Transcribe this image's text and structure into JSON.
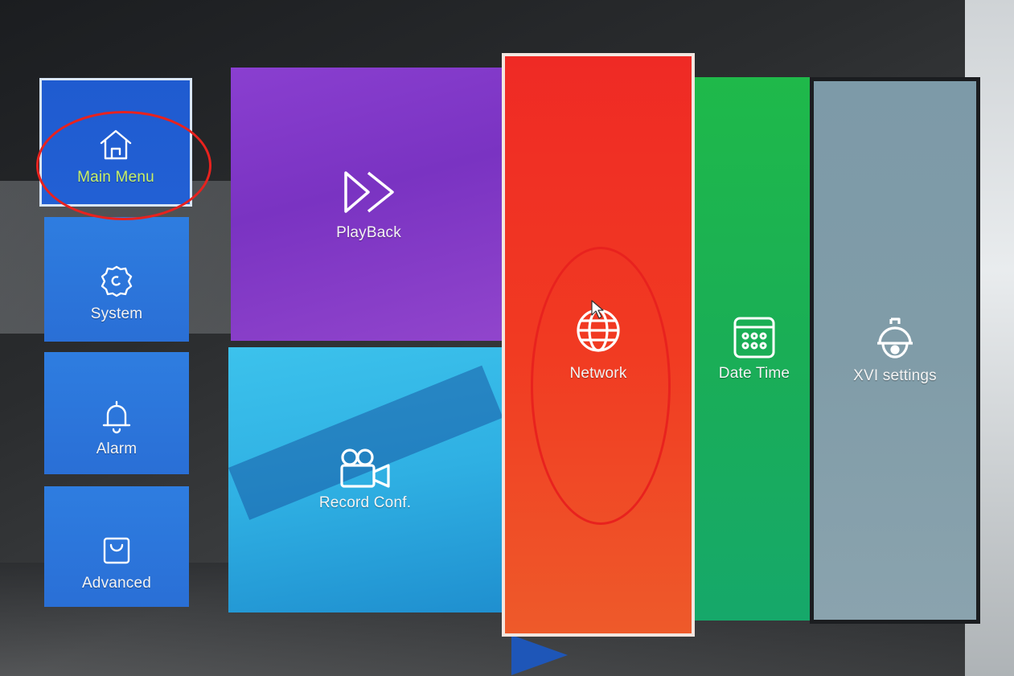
{
  "main_menu": {
    "sidebar": [
      {
        "id": "main-menu",
        "label": "Main Menu",
        "icon": "home-icon",
        "active": true
      },
      {
        "id": "system",
        "label": "System",
        "icon": "gear-icon"
      },
      {
        "id": "alarm",
        "label": "Alarm",
        "icon": "bell-icon"
      },
      {
        "id": "advanced",
        "label": "Advanced",
        "icon": "bag-icon"
      }
    ],
    "tiles": [
      {
        "id": "playback",
        "label": "PlayBack",
        "icon": "fast-forward-icon"
      },
      {
        "id": "record",
        "label": "Record Conf.",
        "icon": "video-camera-icon"
      },
      {
        "id": "network",
        "label": "Network",
        "icon": "globe-icon",
        "active": true
      },
      {
        "id": "datetime",
        "label": "Date Time",
        "icon": "calendar-icon"
      },
      {
        "id": "xvi",
        "label": "XVI settings",
        "icon": "dome-camera-icon"
      }
    ]
  },
  "colors": {
    "sidebar": "#2e7de0",
    "sidebar_active": "#1f5bd0",
    "active_label": "#c8f06a",
    "playback": "#8a3fd0",
    "record": "#3cc2ec",
    "network": "#ef2a25",
    "datetime": "#1fb94a",
    "xvi": "#7d9aa8",
    "annotation": "#e8221e"
  }
}
